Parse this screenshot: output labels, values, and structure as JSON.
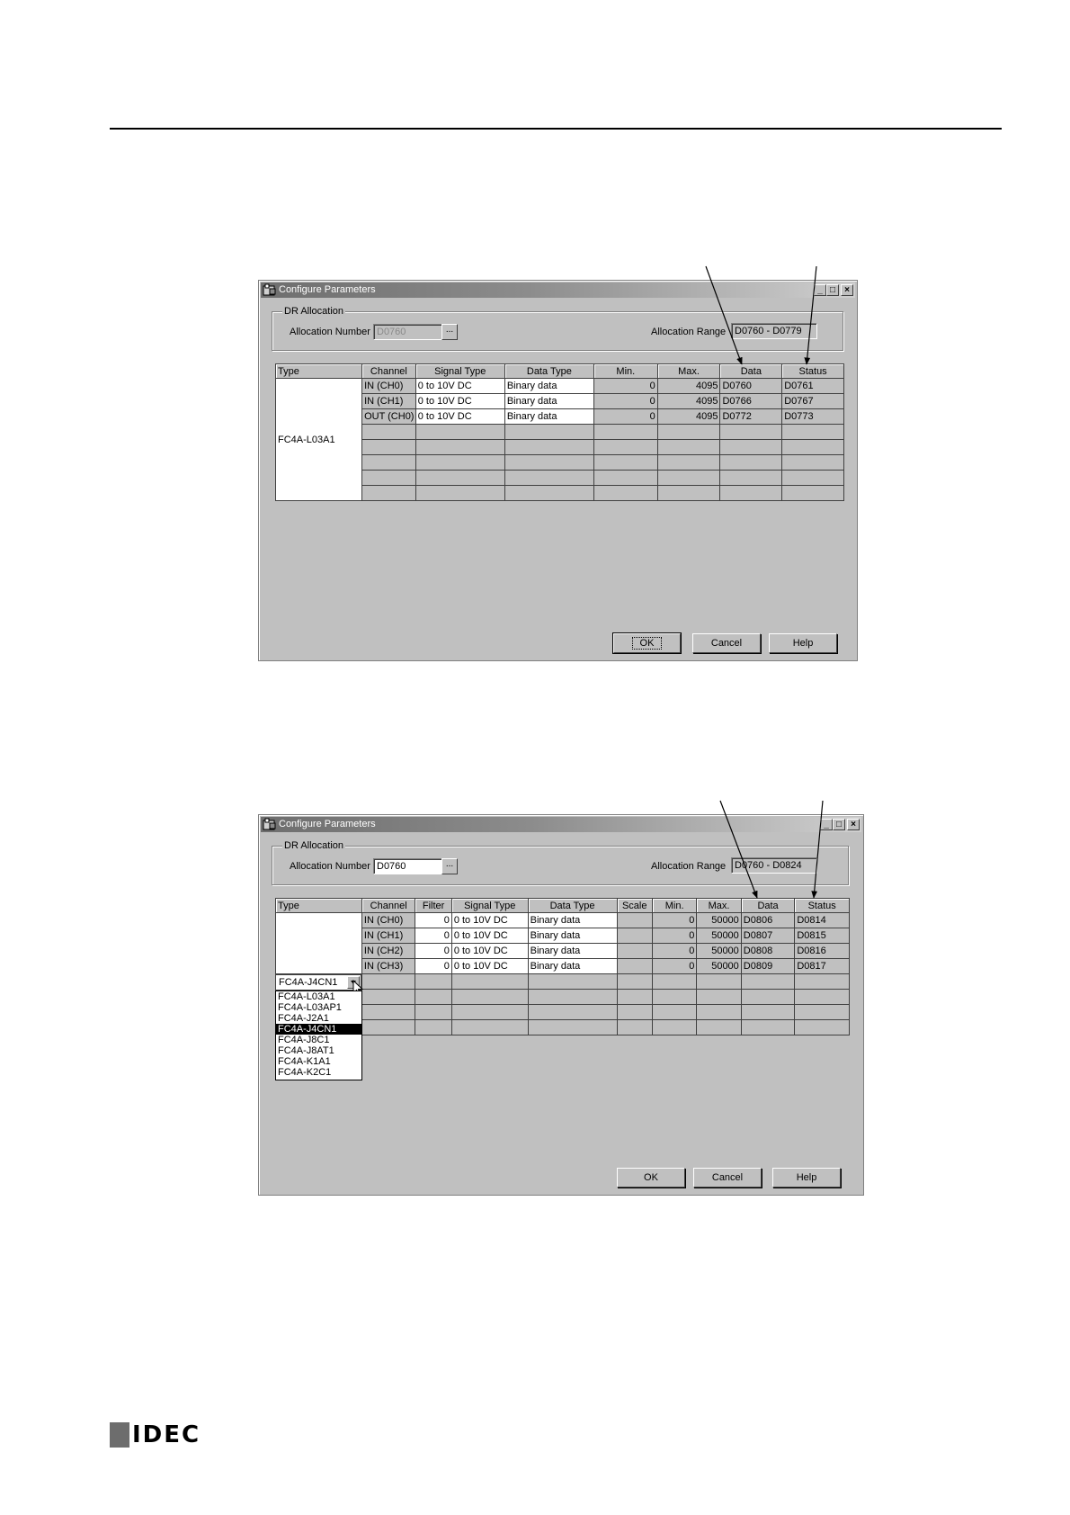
{
  "dialog1": {
    "title": "Configure Parameters",
    "group_label": "DR Allocation",
    "alloc_number_label": "Allocation Number",
    "alloc_number_value": "D0760",
    "alloc_range_label": "Allocation Range",
    "alloc_range_value": "D0760 - D0779",
    "ellipsis": "...",
    "headers": [
      "Type",
      "Channel",
      "Signal Type",
      "Data Type",
      "Min.",
      "Max.",
      "Data",
      "Status"
    ],
    "type_value": "FC4A-L03A1",
    "rows": [
      {
        "channel": "IN (CH0)",
        "signal": "0 to 10V DC",
        "datatype": "Binary data",
        "min": "0",
        "max": "4095",
        "data": "D0760",
        "status": "D0761"
      },
      {
        "channel": "IN (CH1)",
        "signal": "0 to 10V DC",
        "datatype": "Binary data",
        "min": "0",
        "max": "4095",
        "data": "D0766",
        "status": "D0767"
      },
      {
        "channel": "OUT (CH0)",
        "signal": "0 to 10V DC",
        "datatype": "Binary data",
        "min": "0",
        "max": "4095",
        "data": "D0772",
        "status": "D0773"
      }
    ],
    "ok": "OK",
    "cancel": "Cancel",
    "help": "Help"
  },
  "dialog2": {
    "title": "Configure Parameters",
    "group_label": "DR Allocation",
    "alloc_number_label": "Allocation Number",
    "alloc_number_value": "D0760",
    "alloc_range_label": "Allocation Range",
    "alloc_range_value": "D0760 - D0824",
    "ellipsis": "...",
    "headers": [
      "Type",
      "Channel",
      "Filter",
      "Signal Type",
      "Data Type",
      "Scale",
      "Min.",
      "Max.",
      "Data",
      "Status"
    ],
    "combo_value": "FC4A-J4CN1",
    "dropdown_options": [
      "FC4A-L03A1",
      "FC4A-L03AP1",
      "FC4A-J2A1",
      "FC4A-J4CN1",
      "FC4A-J8C1",
      "FC4A-J8AT1",
      "FC4A-K1A1",
      "FC4A-K2C1"
    ],
    "dropdown_selected": "FC4A-J4CN1",
    "rows": [
      {
        "channel": "IN (CH0)",
        "filter": "0",
        "signal": "0 to 10V DC",
        "datatype": "Binary data",
        "min": "0",
        "max": "50000",
        "data": "D0806",
        "status": "D0814"
      },
      {
        "channel": "IN (CH1)",
        "filter": "0",
        "signal": "0 to 10V DC",
        "datatype": "Binary data",
        "min": "0",
        "max": "50000",
        "data": "D0807",
        "status": "D0815"
      },
      {
        "channel": "IN (CH2)",
        "filter": "0",
        "signal": "0 to 10V DC",
        "datatype": "Binary data",
        "min": "0",
        "max": "50000",
        "data": "D0808",
        "status": "D0816"
      },
      {
        "channel": "IN (CH3)",
        "filter": "0",
        "signal": "0 to 10V DC",
        "datatype": "Binary data",
        "min": "0",
        "max": "50000",
        "data": "D0809",
        "status": "D0817"
      }
    ],
    "ok": "OK",
    "cancel": "Cancel",
    "help": "Help"
  },
  "footer": {
    "logo_text": "IDEC"
  }
}
